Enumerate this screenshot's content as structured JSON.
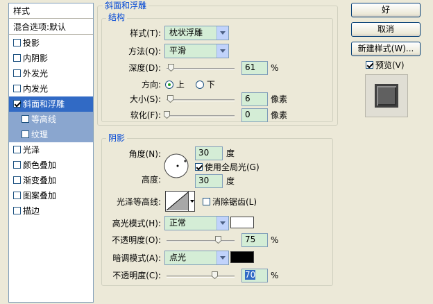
{
  "style_list": {
    "header": "样式",
    "blend_default": "混合选项:默认",
    "items": [
      {
        "label": "投影",
        "checked": false
      },
      {
        "label": "内阴影",
        "checked": false
      },
      {
        "label": "外发光",
        "checked": false
      },
      {
        "label": "内发光",
        "checked": false
      },
      {
        "label": "斜面和浮雕",
        "checked": true,
        "selected": true
      },
      {
        "label": "等高线",
        "checked": false,
        "sub": true
      },
      {
        "label": "纹理",
        "checked": false,
        "sub": true
      },
      {
        "label": "光泽",
        "checked": false
      },
      {
        "label": "颜色叠加",
        "checked": false
      },
      {
        "label": "渐变叠加",
        "checked": false
      },
      {
        "label": "图案叠加",
        "checked": false
      },
      {
        "label": "描边",
        "checked": false
      }
    ]
  },
  "bevel": {
    "section_title": "斜面和浮雕",
    "structure_title": "结构",
    "style_label": "样式(T):",
    "style_value": "枕状浮雕",
    "method_label": "方法(Q):",
    "method_value": "平滑",
    "depth_label": "深度(D):",
    "depth_value": "61",
    "depth_unit": "%",
    "depth_level": 0.06,
    "direction_label": "方向:",
    "direction_up": "上",
    "direction_down": "下",
    "size_label": "大小(S):",
    "size_value": "6",
    "size_unit": "像素",
    "size_level": 0.05,
    "soften_label": "软化(F):",
    "soften_value": "0",
    "soften_unit": "像素",
    "soften_level": 0.0
  },
  "shading": {
    "title": "阴影",
    "angle_label": "角度(N):",
    "angle_value": "30",
    "angle_unit": "度",
    "global_light_label": "使用全局光(G)",
    "altitude_label": "高度:",
    "altitude_value": "30",
    "altitude_unit": "度",
    "gloss_label": "光泽等高线:",
    "antialias_label": "消除锯齿(L)",
    "highlight_mode_label": "高光模式(H):",
    "highlight_mode_value": "正常",
    "highlight_color": "#ffffff",
    "highlight_opacity_label": "不透明度(O):",
    "highlight_opacity_value": "75",
    "highlight_opacity_unit": "%",
    "highlight_opacity_level": 0.75,
    "shadow_mode_label": "暗调模式(A):",
    "shadow_mode_value": "点光",
    "shadow_color": "#000000",
    "shadow_opacity_label": "不透明度(C):",
    "shadow_opacity_value": "70",
    "shadow_opacity_unit": "%",
    "shadow_opacity_level": 0.7
  },
  "buttons": {
    "ok": "好",
    "cancel": "取消",
    "new_style": "新建样式(W)...",
    "preview": "预览(V)"
  }
}
